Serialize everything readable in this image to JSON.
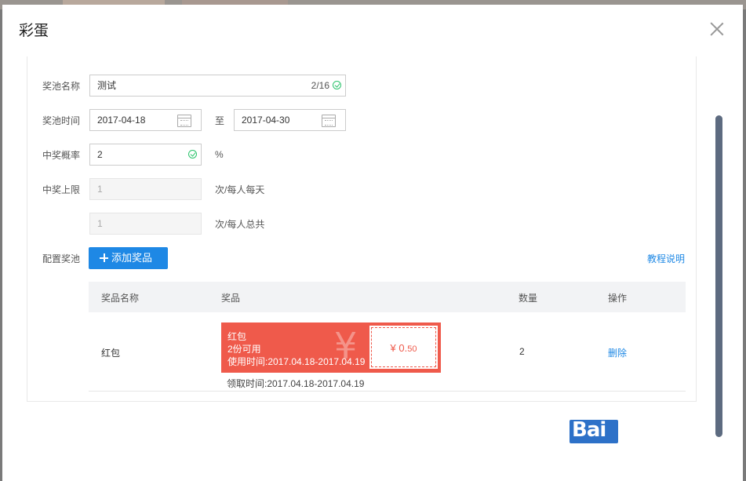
{
  "modal": {
    "title": "彩蛋"
  },
  "form": {
    "pool_name": {
      "label": "奖池名称",
      "value": "测试",
      "counter": "2/16"
    },
    "pool_time": {
      "label": "奖池时间",
      "start": "2017-04-18",
      "separator": "至",
      "end": "2017-04-30"
    },
    "win_rate": {
      "label": "中奖概率",
      "value": "2",
      "unit": "%"
    },
    "win_limit": {
      "label": "中奖上限",
      "daily_value": "1",
      "daily_unit": "次/每人每天",
      "total_value": "1",
      "total_unit": "次/每人总共"
    },
    "config": {
      "label": "配置奖池",
      "add_button": "添加奖品",
      "help_link": "教程说明"
    }
  },
  "table": {
    "headers": [
      "奖品名称",
      "奖品",
      "数量",
      "操作"
    ],
    "rows": [
      {
        "name": "红包",
        "coupon": {
          "title": "红包",
          "available": "2份可用",
          "use_time": "使用时间:2017.04.18-2017.04.19",
          "currency": "¥",
          "amount": "0.",
          "amount_small": "50"
        },
        "claim_time": "领取时间:2017.04.18-2017.04.19",
        "quantity": "2",
        "action": "删除"
      }
    ]
  },
  "watermark": "Bai",
  "colors": {
    "primary": "#1e88e5",
    "coupon": "#ef5a4b",
    "success": "#2bc36b"
  }
}
